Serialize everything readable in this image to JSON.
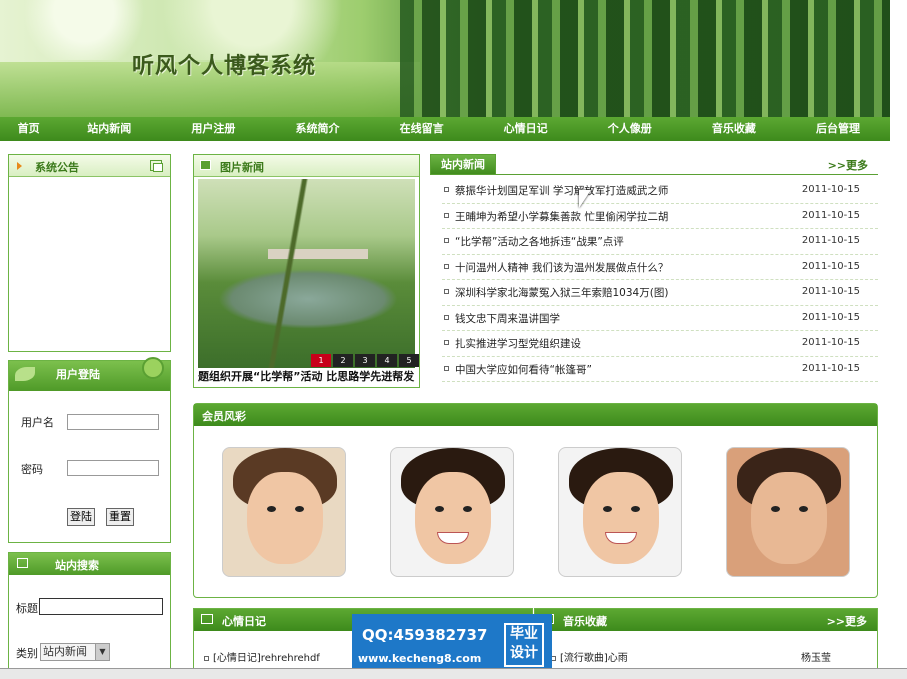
{
  "header": {
    "site_title": "听风个人博客系统"
  },
  "nav": [
    "首页",
    "站内新闻",
    "用户注册",
    "系统简介",
    "在线留言",
    "心情日记",
    "个人像册",
    "音乐收藏",
    "后台管理"
  ],
  "notice": {
    "title": "系统公告"
  },
  "login": {
    "title": "用户登陆",
    "username_label": "用户名",
    "password_label": "密码",
    "login_button": "登陆",
    "reset_button": "重置"
  },
  "site_search": {
    "title": "站内搜索",
    "title_label": "标题",
    "category_label": "类别",
    "category_value": "站内新闻"
  },
  "pic_news": {
    "title": "图片新闻",
    "caption": "题组织开展“比学帮”活动 比思路学先进帮发",
    "pages": [
      "1",
      "2",
      "3",
      "4",
      "5"
    ]
  },
  "site_news": {
    "tab": "站内新闻",
    "more": ">>更多",
    "items": [
      {
        "title": "蔡振华计划国足军训 学习解放军打造威武之师",
        "date": "2011-10-15"
      },
      {
        "title": "王晡坤为希望小学募集善款 忙里偷闲学拉二胡",
        "date": "2011-10-15"
      },
      {
        "title": "“比学帮”活动之各地拆违“战果”点评",
        "date": "2011-10-15"
      },
      {
        "title": "十问温州人精神 我们该为温州发展做点什么？",
        "date": "2011-10-15"
      },
      {
        "title": "深圳科学家北海蒙冤入狱三年索赔1034万(图)",
        "date": "2011-10-15"
      },
      {
        "title": "钱文忠下周来温讲国学",
        "date": "2011-10-15"
      },
      {
        "title": "扎实推进学习型党组织建设",
        "date": "2011-10-15"
      },
      {
        "title": "中国大学应如何看待“帐篷哥”",
        "date": "2011-10-15"
      }
    ]
  },
  "members": {
    "title": "会员风彩"
  },
  "diary": {
    "title": "心情日记",
    "first_item": "[心情日记]rehrehrehdf"
  },
  "music": {
    "title": "音乐收藏",
    "more": ">>更多",
    "first_item": "[流行歌曲]心雨",
    "first_artist": "杨玉莹"
  },
  "watermark": {
    "qq": "QQ:459382737",
    "site": "www.kecheng8.com",
    "badge_line1": "毕业",
    "badge_line2": "设计"
  }
}
